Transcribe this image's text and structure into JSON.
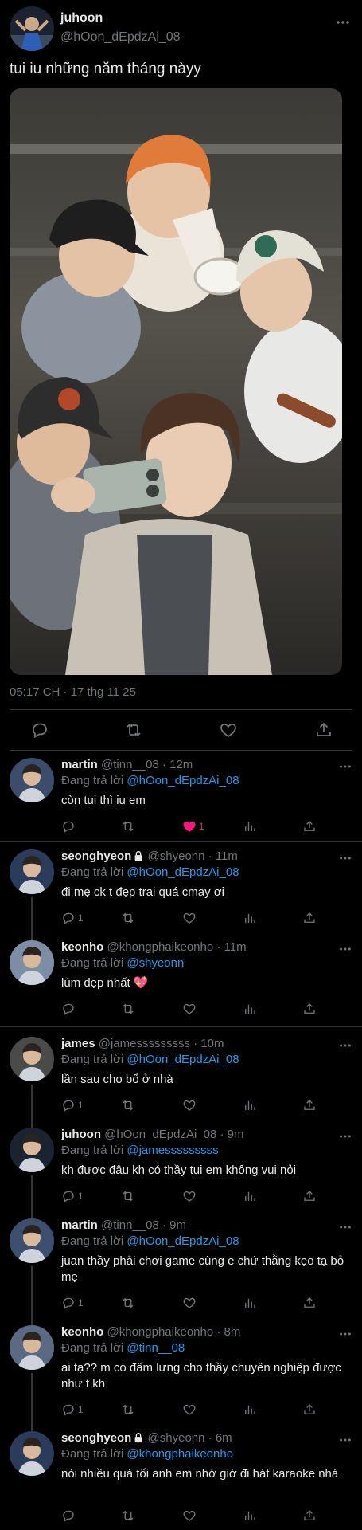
{
  "post": {
    "author_name": "juhoon",
    "author_handle": "@hOon_dEpdzAi_08",
    "text": "tui iu những năm tháng nàyy",
    "timestamp": "05:17 CH · 17 thg 11 25",
    "photo_alt": "group selfie photo"
  },
  "reply_prefix": "Đang trả lời",
  "replies": [
    {
      "name": "martin",
      "handle": "@tinn__08",
      "time": "12m",
      "sep": " · ",
      "replying_to": "@hOon_dEpdzAi_08",
      "text": "còn tui thì iu em",
      "reply_count": "",
      "like_count": "1",
      "liked": true,
      "locked": false
    },
    {
      "name": "seonghyeon",
      "handle": "@shyeonn",
      "time": "11m",
      "sep": " · ",
      "replying_to": "@hOon_dEpdzAi_08",
      "text": "đi mẹ ck t đẹp trai quá cmay ơi",
      "reply_count": "1",
      "like_count": "",
      "liked": false,
      "locked": true
    },
    {
      "name": "keonho",
      "handle": "@khongphaikeonho",
      "time": "11m",
      "sep": " · ",
      "replying_to": "@shyeonn",
      "text": "lúm đẹp nhất 💖",
      "reply_count": "",
      "like_count": "",
      "liked": false,
      "locked": false
    },
    {
      "name": "james",
      "handle": "@jamesssssssss",
      "time": "10m",
      "sep": " · ",
      "replying_to": "@hOon_dEpdzAi_08",
      "text": "lần sau cho bổ ở nhà",
      "reply_count": "1",
      "like_count": "",
      "liked": false,
      "locked": false
    },
    {
      "name": "juhoon",
      "handle": "@hOon_dEpdzAi_08",
      "time": "9m",
      "sep": " · ",
      "replying_to": "@jamesssssssss",
      "text": "kh được đâu kh có thầy tụi em không vui nỏi",
      "reply_count": "1",
      "like_count": "",
      "liked": false,
      "locked": false
    },
    {
      "name": "martin",
      "handle": "@tinn__08",
      "time": "9m",
      "sep": " · ",
      "replying_to": "@hOon_dEpdzAi_08",
      "text": "juan thầy phải chơi game cùng e chứ thằng kẹo tạ bỏ mẹ",
      "reply_count": "1",
      "like_count": "",
      "liked": false,
      "locked": false
    },
    {
      "name": "keonho",
      "handle": "@khongphaikeonho",
      "time": "8m",
      "sep": " · ",
      "replying_to": "@tinn__08",
      "text": "ai tạ?? m có đấm lưng cho thầy chuyên nghiệp được như t kh",
      "reply_count": "1",
      "like_count": "",
      "liked": false,
      "locked": false
    },
    {
      "name": "seonghyeon",
      "handle": "@shyeonn",
      "time": "6m",
      "sep": " · ",
      "replying_to": "@khongphaikeonho",
      "text": "nói nhiều quá tối anh em nhớ giờ đi hát karaoke nhá",
      "reply_count": "",
      "like_count": "",
      "liked": false,
      "locked": true
    }
  ],
  "colors": {
    "background": "#000000",
    "text": "#e7e9ea",
    "muted": "#71767b",
    "link": "#1d9bf0",
    "like": "#f91880",
    "divider": "#2f3336"
  }
}
